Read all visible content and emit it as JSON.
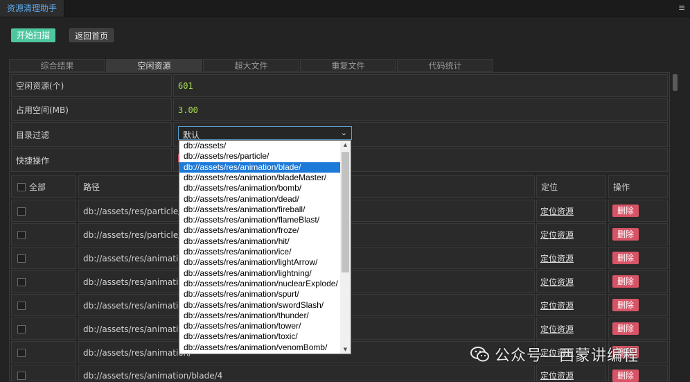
{
  "app": {
    "title": "资源清理助手"
  },
  "toolbar": {
    "scan_label": "开始扫描",
    "home_label": "返回首页"
  },
  "tabs": [
    {
      "label": "综合结果",
      "active": false
    },
    {
      "label": "空闲资源",
      "active": true
    },
    {
      "label": "超大文件",
      "active": false
    },
    {
      "label": "重复文件",
      "active": false
    },
    {
      "label": "代码统计",
      "active": false
    }
  ],
  "summary": {
    "idle_count_label": "空闲资源(个)",
    "idle_count_value": "601",
    "space_label": "占用空间(MB)",
    "space_value": "3.00",
    "filter_label": "目录过滤",
    "filter_value": "默认",
    "quick_label": "快捷操作"
  },
  "table": {
    "headers": {
      "all": "全部",
      "path": "路径",
      "locate": "定位",
      "action": "操作"
    },
    "rows": [
      {
        "path": "db://assets/res/particle/wu",
        "locate": "定位资源",
        "action": "删除"
      },
      {
        "path": "db://assets/res/particle/wu",
        "locate": "定位资源",
        "action": "删除"
      },
      {
        "path": "db://assets/res/animation/",
        "locate": "定位资源",
        "action": "删除"
      },
      {
        "path": "db://assets/res/animation/",
        "locate": "定位资源",
        "action": "删除"
      },
      {
        "path": "db://assets/res/animation/",
        "locate": "定位资源",
        "action": "删除"
      },
      {
        "path": "db://assets/res/animation/",
        "locate": "定位资源",
        "action": "删除"
      },
      {
        "path": "db://assets/res/animation/",
        "locate": "定位资源",
        "action": "删除"
      },
      {
        "path": "db://assets/res/animation/blade/4",
        "locate": "定位资源",
        "action": "删除"
      }
    ]
  },
  "dropdown": {
    "selected_index": 2,
    "options": [
      "db://assets/",
      "db://assets/res/particle/",
      "db://assets/res/animation/blade/",
      "db://assets/res/animation/bladeMaster/",
      "db://assets/res/animation/bomb/",
      "db://assets/res/animation/dead/",
      "db://assets/res/animation/fireball/",
      "db://assets/res/animation/flameBlast/",
      "db://assets/res/animation/froze/",
      "db://assets/res/animation/hit/",
      "db://assets/res/animation/ice/",
      "db://assets/res/animation/lightArrow/",
      "db://assets/res/animation/lightning/",
      "db://assets/res/animation/nuclearExplode/",
      "db://assets/res/animation/spurt/",
      "db://assets/res/animation/swordSlash/",
      "db://assets/res/animation/thunder/",
      "db://assets/res/animation/tower/",
      "db://assets/res/animation/toxic/",
      "db://assets/res/animation/venomBomb/"
    ]
  },
  "watermark": {
    "text": "公众号 · 西蒙讲编程"
  },
  "colors": {
    "accent_green": "#4ec7a0",
    "value_green": "#a7e04a",
    "delete_red": "#d75466",
    "select_blue": "#1e7ad8"
  }
}
